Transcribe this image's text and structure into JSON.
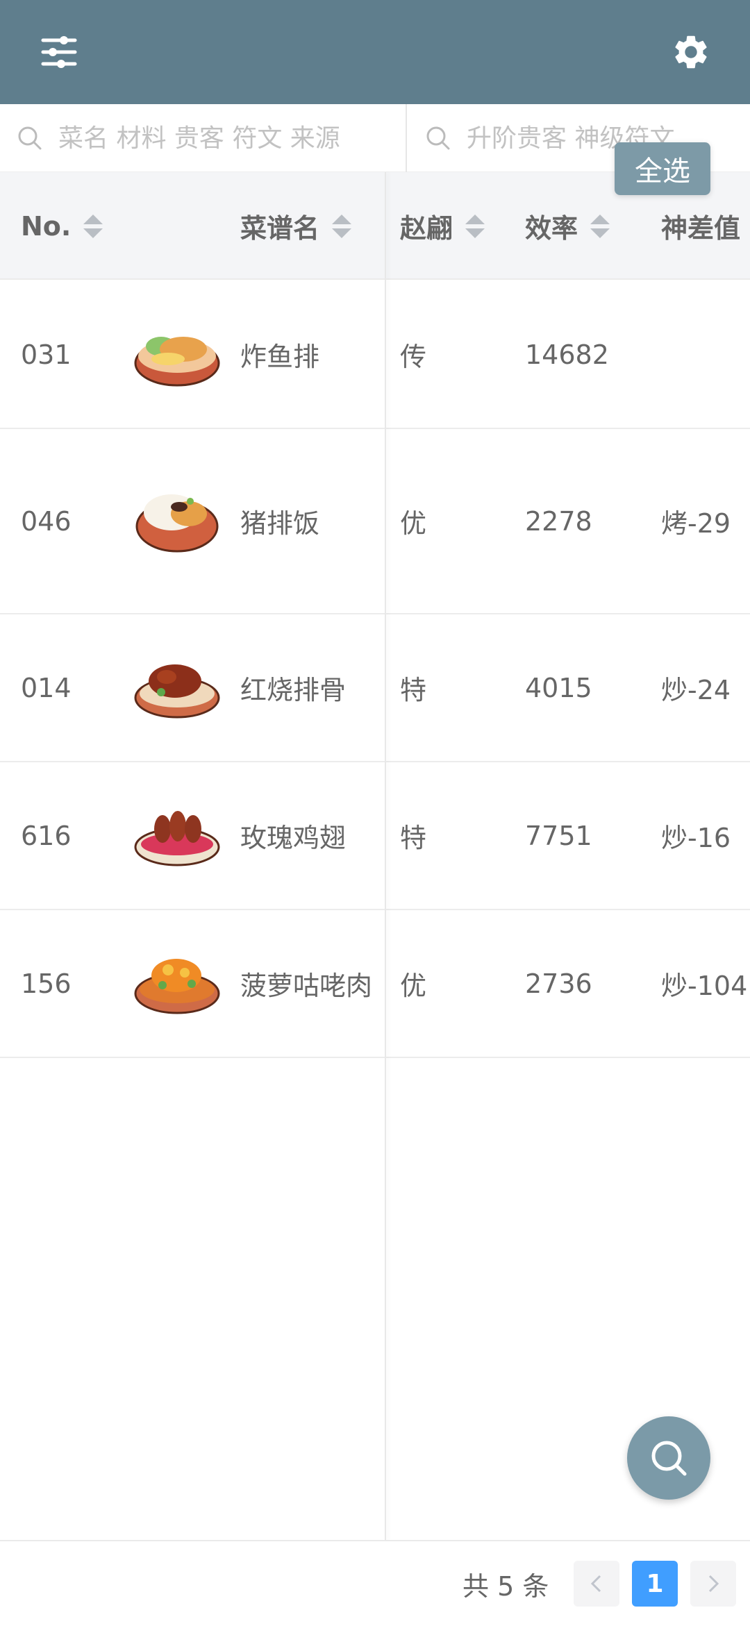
{
  "header": {
    "menu_icon": "sliders-icon",
    "settings_icon": "gear-icon"
  },
  "search": {
    "left_placeholder": "菜名 材料 贵客 符文 来源",
    "right_placeholder": "升阶贵客 神级符文"
  },
  "select_all_label": "全选",
  "columns": [
    "No.",
    "菜谱名",
    "赵翩",
    "效率",
    "神差值"
  ],
  "rows": [
    {
      "no": "031",
      "name": "炸鱼排",
      "grade": "传",
      "efficiency": "14682",
      "diff": ""
    },
    {
      "no": "046",
      "name": "猪排饭",
      "grade": "优",
      "efficiency": "2278",
      "diff": "烤-29"
    },
    {
      "no": "014",
      "name": "红烧排骨",
      "grade": "特",
      "efficiency": "4015",
      "diff": "炒-24"
    },
    {
      "no": "616",
      "name": "玫瑰鸡翅",
      "grade": "特",
      "efficiency": "7751",
      "diff": "炒-16"
    },
    {
      "no": "156",
      "name": "菠萝咕咾肉",
      "grade": "优",
      "efficiency": "2736",
      "diff": "炒-104"
    }
  ],
  "pagination": {
    "total_label": "共 5 条",
    "current_page": "1"
  },
  "colors": {
    "header": "#5f7e8d",
    "accent": "#409eff",
    "fab": "#7b9aa8"
  }
}
